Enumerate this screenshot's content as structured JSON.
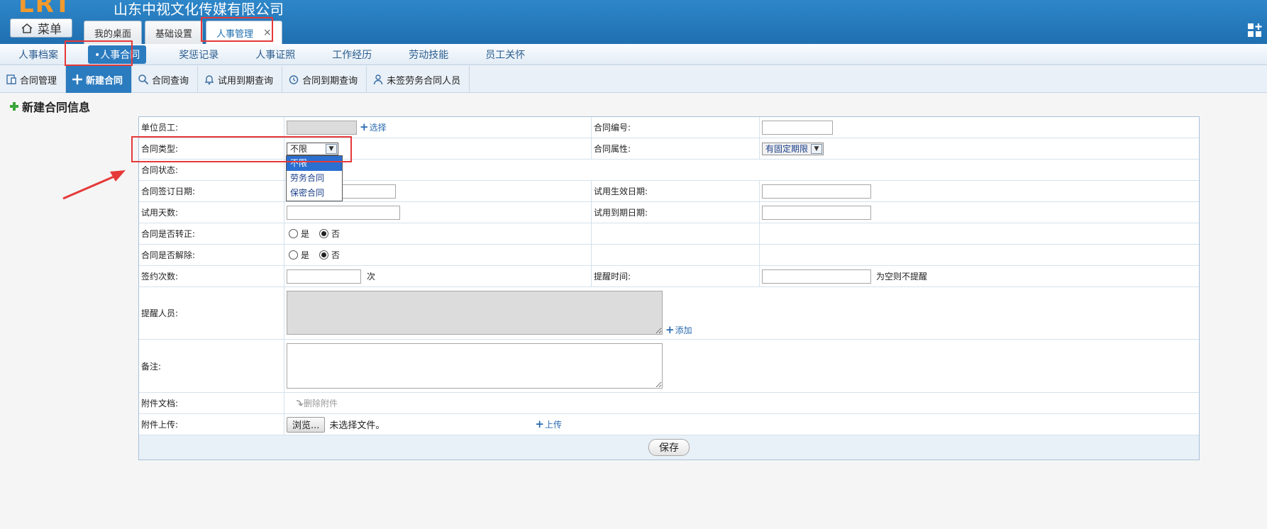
{
  "header": {
    "logo_text": "LRT",
    "company": "山东中视文化传媒有限公司",
    "menu_label": "菜单",
    "tabs": [
      {
        "label": "我的桌面",
        "active": false
      },
      {
        "label": "基础设置",
        "active": false
      },
      {
        "label": "人事管理",
        "active": true,
        "close": "×"
      }
    ]
  },
  "subnav": {
    "items": [
      {
        "label": "人事档案",
        "active": false
      },
      {
        "label": "•人事合同",
        "active": true
      },
      {
        "label": "奖惩记录",
        "active": false
      },
      {
        "label": "人事证照",
        "active": false
      },
      {
        "label": "工作经历",
        "active": false
      },
      {
        "label": "劳动技能",
        "active": false
      },
      {
        "label": "员工关怀",
        "active": false
      }
    ]
  },
  "toolbar": {
    "items": [
      {
        "label": "合同管理",
        "icon": "contract-icon"
      },
      {
        "label": "新建合同",
        "icon": "plus-icon",
        "active": true
      },
      {
        "label": "合同查询",
        "icon": "search-icon"
      },
      {
        "label": "试用到期查询",
        "icon": "bell-icon"
      },
      {
        "label": "合同到期查询",
        "icon": "clock-icon"
      },
      {
        "label": "未签劳务合同人员",
        "icon": "user-icon"
      }
    ]
  },
  "section_title": "新建合同信息",
  "form": {
    "unit_employee": {
      "label": "单位员工:",
      "link": "选择",
      "value": ""
    },
    "contract_no": {
      "label": "合同编号:",
      "value": ""
    },
    "contract_type": {
      "label": "合同类型:",
      "selected": "不限",
      "options": [
        "不限",
        "劳务合同",
        "保密合同"
      ]
    },
    "contract_attr": {
      "label": "合同属性:",
      "selected": "有固定期限"
    },
    "contract_status": {
      "label": "合同状态:"
    },
    "sign_date": {
      "label": "合同签订日期:",
      "value": ""
    },
    "trial_effective_date": {
      "label": "试用生效日期:",
      "value": ""
    },
    "trial_days": {
      "label": "试用天数:",
      "value": ""
    },
    "trial_end_date": {
      "label": "试用到期日期:",
      "value": ""
    },
    "regularized": {
      "label": "合同是否转正:",
      "yes": "是",
      "no": "否",
      "value": "否"
    },
    "terminated": {
      "label": "合同是否解除:",
      "yes": "是",
      "no": "否",
      "value": "否"
    },
    "sign_count": {
      "label": "签约次数:",
      "unit": "次",
      "value": ""
    },
    "remind_time": {
      "label": "提醒时间:",
      "hint": "为空则不提醒",
      "value": ""
    },
    "remind_people": {
      "label": "提醒人员:",
      "link": "添加"
    },
    "remarks": {
      "label": "备注:"
    },
    "attachments": {
      "label": "附件文档:",
      "delete_link": "删除附件"
    },
    "upload": {
      "label": "附件上传:",
      "browse": "浏览...",
      "no_file": "未选择文件。",
      "upload_link": "上传"
    },
    "save_label": "保存"
  },
  "colors": {
    "header": "#2e87c9",
    "active_blue": "#2b7bbf",
    "logo_orange": "#f39a2c",
    "highlight_red": "#e53939"
  }
}
